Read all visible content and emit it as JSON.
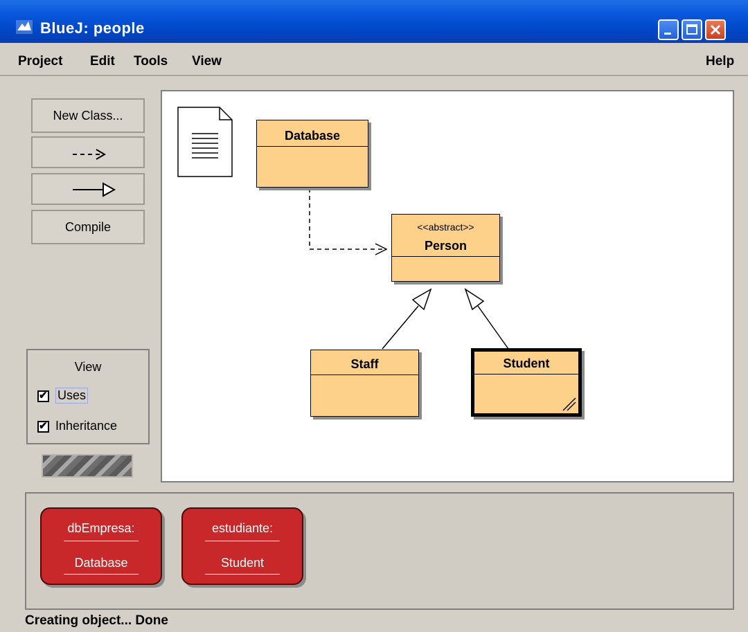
{
  "window": {
    "title": "BlueJ:  people"
  },
  "menu": {
    "items": [
      "Project",
      "Edit",
      "Tools",
      "View"
    ],
    "help": "Help"
  },
  "toolbar": {
    "new_class": "New Class...",
    "uses_arrow": "- - ->",
    "inherit_arrow": "—▷",
    "compile": "Compile"
  },
  "view_panel": {
    "title": "View",
    "uses": "Uses",
    "inheritance": "Inheritance",
    "uses_checked": true,
    "inheritance_checked": true
  },
  "diagram": {
    "classes": {
      "database": {
        "name": "Database"
      },
      "person": {
        "name": "Person",
        "stereotype": "<<abstract>>"
      },
      "staff": {
        "name": "Staff"
      },
      "student": {
        "name": "Student"
      }
    }
  },
  "bench": {
    "objects": [
      {
        "name": "dbEmpresa:",
        "type": "Database"
      },
      {
        "name": "estudiante:",
        "type": "Student"
      }
    ]
  },
  "status": "Creating object... Done",
  "colors": {
    "class_fill": "#fed18b",
    "object_fill": "#c8282a",
    "titlebar": "#0a58dc"
  }
}
